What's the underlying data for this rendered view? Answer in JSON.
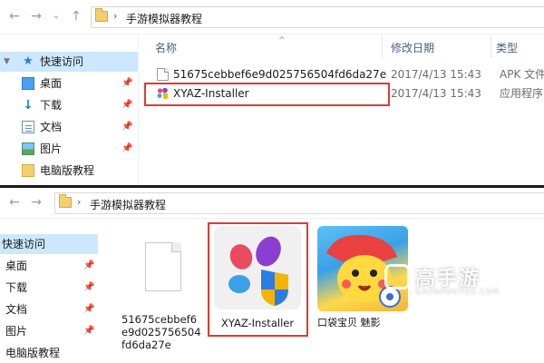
{
  "top": {
    "address": {
      "separator": "›",
      "path": "手游模拟器教程"
    },
    "sidebar": [
      {
        "label": "快速访问",
        "icon": "star-icon",
        "pinned": false,
        "selected": true
      },
      {
        "label": "桌面",
        "icon": "desktop-icon",
        "pinned": true
      },
      {
        "label": "下载",
        "icon": "download-icon",
        "pinned": true
      },
      {
        "label": "文档",
        "icon": "document-icon",
        "pinned": true
      },
      {
        "label": "图片",
        "icon": "pictures-icon",
        "pinned": true
      },
      {
        "label": "电脑版教程",
        "icon": "folder-icon",
        "pinned": false
      }
    ],
    "columns": {
      "name": "名称",
      "date": "修改日期",
      "type": "类型"
    },
    "files": [
      {
        "name": "51675cebbef6e9d025756504fd6da27e",
        "date": "2017/4/13 15:43",
        "type": "APK 文件",
        "icon": "file-icon"
      },
      {
        "name": "XYAZ-Installer",
        "date": "2017/4/13 15:43",
        "type": "应用程序",
        "icon": "xyaz-app-icon",
        "highlighted": true
      }
    ]
  },
  "bottom": {
    "address": {
      "separator": "›",
      "path": "手游模拟器教程"
    },
    "sidebar": [
      {
        "label": "快速访问",
        "selected": true
      },
      {
        "label": "桌面",
        "pinned": true
      },
      {
        "label": "下载",
        "pinned": true
      },
      {
        "label": "文档",
        "pinned": true
      },
      {
        "label": "图片",
        "pinned": true
      },
      {
        "label": "电脑版教程"
      }
    ],
    "tiles": [
      {
        "label": "51675cebbef6e9d025756504fd6da27e",
        "icon": "blank-file-icon"
      },
      {
        "label": "XYAZ-Installer",
        "icon": "xyaz-installer-icon",
        "highlighted": true
      },
      {
        "label": "口袋宝贝 魅影",
        "icon": "game-icon"
      }
    ]
  },
  "watermark": {
    "title": "高手游",
    "subtitle": "GAOSHOUYOU.COM"
  },
  "icons": {
    "back": "←",
    "forward": "→",
    "up": "↑",
    "dropdown": "⌄",
    "pin": "📌"
  },
  "colors": {
    "highlight_border": "#e03a32",
    "selection": "#cce8ff",
    "accent": "#2b7de1"
  }
}
